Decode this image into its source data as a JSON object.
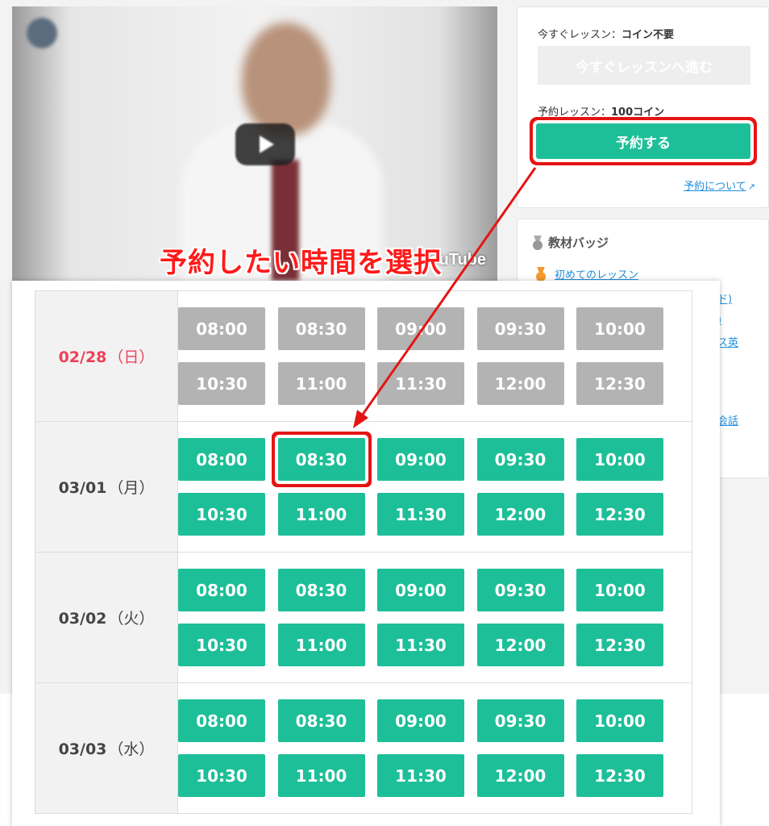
{
  "annotation": "予約したい時間を選択",
  "video": {
    "logo": "YouTube"
  },
  "booking": {
    "now_label_prefix": "今すぐレッスン：",
    "now_label_value": "コイン不要",
    "now_button": "今すぐレッスンへ進む",
    "reserve_label_prefix": "予約レッスン：",
    "reserve_label_value": "100コイン",
    "reserve_button": "予約する",
    "about_link": "予約について"
  },
  "badges": {
    "title": "教材バッジ",
    "first": "初めてのレッスン",
    "peek_1": "ド)",
    "peek_2": ")",
    "peek_3": "ス英",
    "peek_4": "会話"
  },
  "schedule": [
    {
      "date": "02/28",
      "dow": "（日）",
      "available": false,
      "slots": [
        "08:00",
        "08:30",
        "09:00",
        "09:30",
        "10:00",
        "10:30",
        "11:00",
        "11:30",
        "12:00",
        "12:30"
      ]
    },
    {
      "date": "03/01",
      "dow": "（月）",
      "available": true,
      "slots": [
        "08:00",
        "08:30",
        "09:00",
        "09:30",
        "10:00",
        "10:30",
        "11:00",
        "11:30",
        "12:00",
        "12:30"
      ]
    },
    {
      "date": "03/02",
      "dow": "（火）",
      "available": true,
      "slots": [
        "08:00",
        "08:30",
        "09:00",
        "09:30",
        "10:00",
        "10:30",
        "11:00",
        "11:30",
        "12:00",
        "12:30"
      ]
    },
    {
      "date": "03/03",
      "dow": "（水）",
      "available": true,
      "slots": [
        "08:00",
        "08:30",
        "09:00",
        "09:30",
        "10:00",
        "10:30",
        "11:00",
        "11:30",
        "12:00",
        "12:30"
      ]
    }
  ],
  "colors": {
    "accent": "#1dbf98",
    "disabled": "#b3b3b3",
    "highlight": "#e51414",
    "sunday": "#ef4058"
  }
}
